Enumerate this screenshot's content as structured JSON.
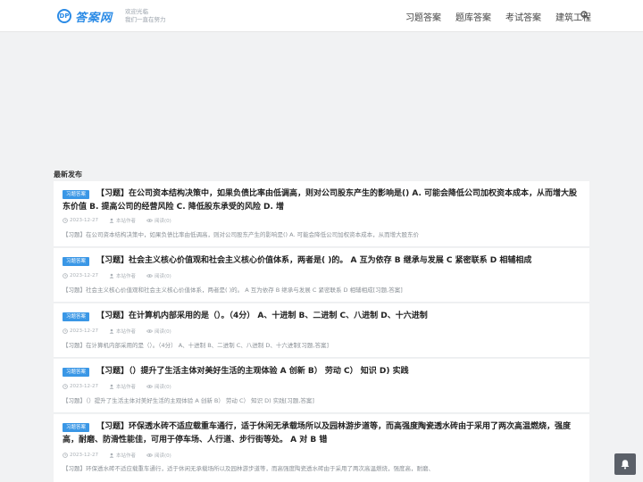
{
  "header": {
    "logo_mark": "DP",
    "logo_text": "答案网",
    "slogan_line1": "欢迎光临",
    "slogan_line2": "我们一直在努力",
    "nav": [
      {
        "label": "习题答案"
      },
      {
        "label": "题库答案"
      },
      {
        "label": "考试答案"
      },
      {
        "label": "建筑工程"
      }
    ]
  },
  "section": {
    "title": "最新发布"
  },
  "posts": [
    {
      "badge": "习题答案",
      "title": "【习题】在公司资本结构决策中，如果负债比率由低调高，则对公司股东产生的影响是() A. 可能会降低公司加权资本成本，从而增大股东价值 B. 提高公司的经营风险 C. 降低股东承受的风险 D. 增",
      "date": "2023-12-27",
      "author": "本站作者",
      "views": "阅读(0)",
      "excerpt": "【习题】在公司资本结构决策中，如果负债比率由低调高，则对公司股东产生的影响是() A. 可能会降低公司加权资本成本，从而增大股东价"
    },
    {
      "badge": "习题答案",
      "title": "【习题】社会主义核心价值观和社会主义核心价值体系，两者是( )的。 A 互为依存 B 继承与发展 C 紧密联系 D 相辅相成",
      "date": "2023-12-27",
      "author": "本站作者",
      "views": "阅读(0)",
      "excerpt": "【习题】社会主义核心价值观和社会主义核心价值体系，两者是( )的。 A 互为依存 B 继承与发展 C 紧密联系 D 相辅相成[习题,答案]"
    },
    {
      "badge": "习题答案",
      "title": "【习题】在计算机内部采用的是（）。（4分） A、十进制 B、二进制 C、八进制 D、十六进制",
      "date": "2023-12-27",
      "author": "本站作者",
      "views": "阅读(0)",
      "excerpt": "【习题】在计算机内部采用的是（）。（4分） A、十进制 B、二进制 C、八进制 D、十六进制[习题,答案]"
    },
    {
      "badge": "习题答案",
      "title": "【习题】（）提升了生活主体对美好生活的主观体验 A 创新 B） 劳动 C） 知识 D) 实践",
      "date": "2023-12-27",
      "author": "本站作者",
      "views": "阅读(0)",
      "excerpt": "【习题】（）提升了生活主体对美好生活的主观体验 A 创新 B） 劳动 C） 知识 D) 实践[习题,答案]"
    },
    {
      "badge": "习题答案",
      "title": "【习题】环保透水砖不适应载重车通行，适于休闲无承载场所以及园林游步道等，而高强度陶瓷透水砖由于采用了两次高温燃烧，强度高，耐磨、防滑性能佳，可用于停车场、人行道、步行街等处。 A 对 B 错",
      "date": "2023-12-27",
      "author": "本站作者",
      "views": "阅读(0)",
      "excerpt": "【习题】环保透水砖不适应载重车通行，适于休闲无承载场所以及园林游步道等，而高强度陶瓷透水砖由于采用了两次高温燃烧，强度高，耐磨、"
    }
  ],
  "icons": {
    "search": "search-icon",
    "clock": "clock-icon",
    "user": "user-icon",
    "eye": "eye-icon",
    "bell": "bell-icon"
  },
  "colors": {
    "accent": "#3a97e6",
    "logo": "#2b8be6",
    "float_button": "#5b6068"
  }
}
